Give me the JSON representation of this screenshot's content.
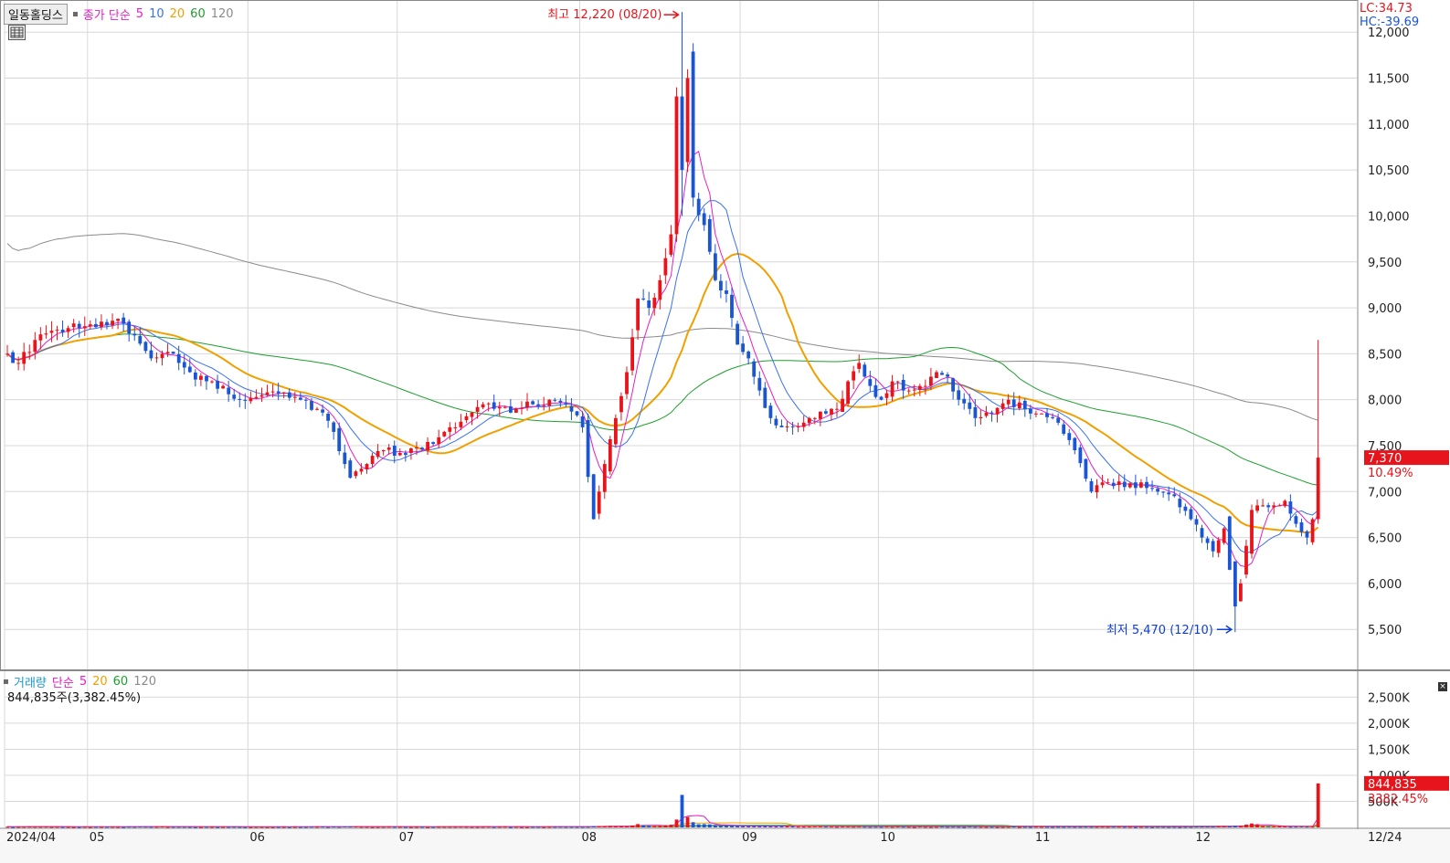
{
  "legend": {
    "stock_name": "일동홀딩스",
    "price_label": "종가 단순",
    "ma": [
      "5",
      "10",
      "20",
      "60",
      "120"
    ],
    "volume_label": "거래량",
    "volume_ma_label": "단순",
    "volume_ma": [
      "5",
      "20",
      "60",
      "120"
    ],
    "volume_current": "844,835주(3,382.45%)"
  },
  "indicators": {
    "lc": "LC:34.73",
    "hc": "HC:-39.69"
  },
  "annotations": {
    "high": {
      "label": "최고 12,220 (08/20)",
      "date_index": 122,
      "value": 12220
    },
    "low": {
      "label": "최저 5,470 (12/10)",
      "date_index": 194,
      "value": 5470
    }
  },
  "current": {
    "price_label": "7,370",
    "change_label": "10.49%",
    "price": 7370,
    "volume_label": "844,835",
    "volume_change_label": "3382.45%",
    "volume": 844835
  },
  "colors": {
    "up": "#e8141b",
    "down": "#1a55d6",
    "ma5": "#e61ec8",
    "ma10": "#3a6ff0",
    "ma20": "#f0a000",
    "ma60": "#1e9e2e",
    "ma120": "#8a8a8a",
    "high_label": "#e8141b",
    "low_label": "#1040d0",
    "grid": "#d8d8d8"
  },
  "chart_data": {
    "type": "candlestick",
    "x_axis": {
      "ticks": [
        {
          "label": "2024/04",
          "index": 0
        },
        {
          "label": "05",
          "index": 15
        },
        {
          "label": "06",
          "index": 44
        },
        {
          "label": "07",
          "index": 71
        },
        {
          "label": "08",
          "index": 104
        },
        {
          "label": "09",
          "index": 133
        },
        {
          "label": "10",
          "index": 158
        },
        {
          "label": "11",
          "index": 186
        },
        {
          "label": "12",
          "index": 215
        }
      ],
      "end_label": "12/24"
    },
    "price_axis": {
      "ylim": [
        5400,
        12200
      ],
      "ticks": [
        5500,
        6000,
        6500,
        7000,
        7500,
        8000,
        8500,
        9000,
        9500,
        10000,
        10500,
        11000,
        11500,
        12000
      ],
      "tick_labels": [
        "5,500",
        "6,000",
        "6,500",
        "7,000",
        "7,500",
        "8,000",
        "8,500",
        "9,000",
        "9,500",
        "10,000",
        "10,500",
        "11,000",
        "11,500",
        "12,000"
      ]
    },
    "volume_axis": {
      "ylim": [
        0,
        2600000
      ],
      "ticks": [
        500000,
        1000000,
        1500000,
        2000000,
        2500000
      ],
      "tick_labels": [
        "500K",
        "1,000K",
        "1,500K",
        "2,000K",
        "2,500K"
      ]
    },
    "anchors": [
      [
        0,
        8500,
        0.5
      ],
      [
        2,
        8400,
        0.4
      ],
      [
        5,
        8650,
        0.5
      ],
      [
        8,
        8750,
        0.4
      ],
      [
        11,
        8780,
        0.4
      ],
      [
        14,
        8800,
        0.5
      ],
      [
        17,
        8850,
        0.4
      ],
      [
        20,
        8880,
        0.4
      ],
      [
        23,
        8700,
        0.5
      ],
      [
        26,
        8450,
        0.5
      ],
      [
        30,
        8500,
        0.5
      ],
      [
        33,
        8300,
        0.4
      ],
      [
        36,
        8200,
        0.5
      ],
      [
        39,
        8150,
        0.4
      ],
      [
        42,
        8000,
        0.4
      ],
      [
        46,
        8050,
        0.4
      ],
      [
        50,
        8080,
        0.4
      ],
      [
        53,
        8000,
        0.4
      ],
      [
        56,
        7900,
        0.5
      ],
      [
        59,
        7650,
        0.6
      ],
      [
        62,
        7150,
        0.6
      ],
      [
        65,
        7300,
        0.5
      ],
      [
        68,
        7450,
        0.5
      ],
      [
        71,
        7420,
        0.5
      ],
      [
        74,
        7480,
        0.4
      ],
      [
        77,
        7520,
        0.4
      ],
      [
        80,
        7700,
        0.5
      ],
      [
        83,
        7820,
        0.5
      ],
      [
        86,
        7950,
        0.5
      ],
      [
        89,
        7920,
        0.5
      ],
      [
        92,
        7900,
        0.5
      ],
      [
        95,
        7950,
        0.5
      ],
      [
        98,
        8000,
        0.5
      ],
      [
        101,
        7950,
        0.5
      ],
      [
        104,
        7700,
        0.5
      ],
      [
        106,
        6700,
        0.9
      ],
      [
        108,
        7300,
        1.0
      ],
      [
        110,
        7800,
        0.8
      ],
      [
        112,
        8300,
        0.9
      ],
      [
        114,
        9100,
        2.5
      ],
      [
        116,
        9000,
        1.2
      ],
      [
        118,
        9300,
        1.1
      ],
      [
        120,
        9800,
        2.0
      ],
      [
        121,
        11300,
        6.0
      ],
      [
        122,
        10500,
        25.0
      ],
      [
        123,
        11500,
        8.0
      ],
      [
        124,
        10200,
        4.0
      ],
      [
        126,
        9900,
        2.5
      ],
      [
        128,
        9300,
        1.8
      ],
      [
        130,
        9150,
        1.4
      ],
      [
        132,
        8600,
        1.2
      ],
      [
        134,
        8450,
        1.0
      ],
      [
        136,
        8100,
        0.9
      ],
      [
        138,
        7800,
        0.8
      ],
      [
        140,
        7700,
        0.9
      ],
      [
        142,
        7700,
        0.7
      ],
      [
        145,
        7800,
        0.6
      ],
      [
        148,
        7850,
        0.6
      ],
      [
        150,
        7900,
        0.5
      ],
      [
        152,
        8200,
        0.6
      ],
      [
        154,
        8400,
        0.6
      ],
      [
        156,
        8150,
        0.5
      ],
      [
        158,
        8000,
        0.5
      ],
      [
        160,
        8200,
        0.5
      ],
      [
        163,
        8100,
        0.5
      ],
      [
        166,
        8150,
        0.5
      ],
      [
        168,
        8300,
        0.5
      ],
      [
        170,
        8250,
        0.5
      ],
      [
        172,
        8000,
        0.5
      ],
      [
        175,
        7800,
        0.5
      ],
      [
        178,
        7850,
        0.5
      ],
      [
        181,
        8000,
        0.5
      ],
      [
        184,
        7900,
        0.5
      ],
      [
        187,
        7850,
        0.5
      ],
      [
        190,
        7750,
        0.5
      ],
      [
        193,
        7450,
        0.5
      ],
      [
        196,
        7000,
        0.5
      ],
      [
        199,
        7100,
        0.5
      ],
      [
        202,
        7050,
        0.5
      ],
      [
        205,
        7100,
        0.5
      ],
      [
        208,
        7000,
        0.5
      ],
      [
        211,
        6950,
        0.5
      ],
      [
        214,
        6700,
        0.5
      ],
      [
        216,
        6500,
        0.6
      ],
      [
        218,
        6350,
        0.6
      ],
      [
        220,
        6600,
        0.8
      ],
      [
        222,
        5750,
        1.2
      ],
      [
        223,
        6000,
        1.0
      ],
      [
        225,
        6800,
        3.0
      ],
      [
        227,
        6850,
        1.0
      ],
      [
        229,
        6850,
        0.8
      ],
      [
        231,
        6900,
        0.7
      ],
      [
        233,
        6650,
        0.6
      ],
      [
        235,
        6500,
        0.6
      ],
      [
        236,
        6700,
        0.6
      ],
      [
        237,
        7370,
        34.0
      ]
    ]
  }
}
